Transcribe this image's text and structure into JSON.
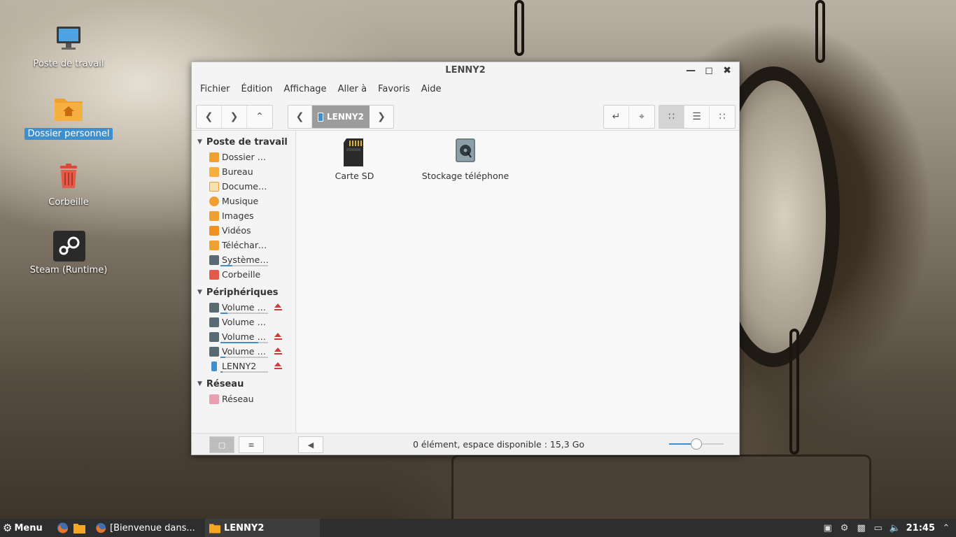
{
  "desktop": {
    "icons": [
      {
        "label": "Poste de travail",
        "icon": "computer-icon"
      },
      {
        "label": "Dossier personnel",
        "icon": "home-folder-icon",
        "selected": true
      },
      {
        "label": "Corbeille",
        "icon": "trash-icon"
      },
      {
        "label": "Steam (Runtime)",
        "icon": "steam-icon"
      }
    ]
  },
  "window": {
    "title": "LENNY2",
    "menu": [
      "Fichier",
      "Édition",
      "Affichage",
      "Aller à",
      "Favoris",
      "Aide"
    ],
    "breadcrumb": "LENNY2",
    "sidebar": {
      "sections": [
        {
          "header": "Poste de travail",
          "items": [
            {
              "label": "Dossier personnel",
              "icon": "home-icon"
            },
            {
              "label": "Bureau",
              "icon": "desktop-icon"
            },
            {
              "label": "Documents",
              "icon": "documents-icon"
            },
            {
              "label": "Musique",
              "icon": "music-icon"
            },
            {
              "label": "Images",
              "icon": "images-icon"
            },
            {
              "label": "Vidéos",
              "icon": "videos-icon"
            },
            {
              "label": "Téléchargements",
              "icon": "downloads-icon"
            },
            {
              "label": "Système de fichiers",
              "icon": "drive-icon",
              "usage": 0.25
            },
            {
              "label": "Corbeille",
              "icon": "trash-icon"
            }
          ]
        },
        {
          "header": "Périphériques",
          "items": [
            {
              "label": "Volume de…",
              "icon": "drive-icon",
              "usage": 0.15,
              "eject": true
            },
            {
              "label": "Volume de…",
              "icon": "drive-icon",
              "eject": false
            },
            {
              "label": "Volume de…",
              "icon": "drive-icon",
              "usage": 0.8,
              "eject": true
            },
            {
              "label": "Volume de…",
              "icon": "drive-icon",
              "usage": 0.1,
              "eject": true
            },
            {
              "label": "LENNY2",
              "icon": "phone-icon",
              "usage": 0.05,
              "eject": true
            }
          ]
        },
        {
          "header": "Réseau",
          "items": [
            {
              "label": "Réseau",
              "icon": "network-icon"
            }
          ]
        }
      ]
    },
    "files": [
      {
        "label": "Carte SD",
        "icon": "sd-card-icon"
      },
      {
        "label": "Stockage téléphone",
        "icon": "phone-storage-icon"
      }
    ],
    "status": "0 élément, espace disponible : 15,3 Go",
    "zoom_level": 0.5
  },
  "taskbar": {
    "menu_label": "Menu",
    "windows": [
      {
        "label": "[Bienvenue dans...",
        "icon": "firefox-icon",
        "active": false
      },
      {
        "label": "LENNY2",
        "icon": "folder-icon",
        "active": true
      }
    ],
    "clock": "21:45"
  }
}
